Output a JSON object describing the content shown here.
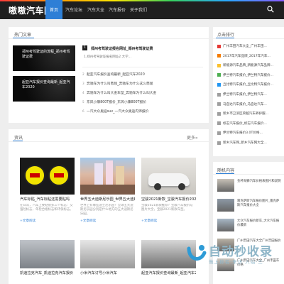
{
  "site": {
    "logo": "嗷嗷汽车网"
  },
  "nav": [
    {
      "label": "首页",
      "active": true
    },
    {
      "label": "汽车论坛",
      "active": false
    },
    {
      "label": "汽车大全",
      "active": false
    },
    {
      "label": "汽车报价",
      "active": false
    },
    {
      "label": "关于我们",
      "active": false
    }
  ],
  "hot": {
    "title": "热门文章",
    "featured": [
      {
        "label": "郑州考驾驶证的流程_郑州考驾驶证费"
      },
      {
        "label": "起亚汽车报价查询最新_起亚汽车2020"
      }
    ],
    "headline": {
      "number": "1",
      "title": "郑州考驾驶证报名网址_郑州考驾驶证费",
      "summary": "1.郑州考驾驶证报名网址2.大学..."
    },
    "list": [
      {
        "number": "2",
        "title": "起亚汽车报价查询最新_起亚汽车2020"
      },
      {
        "number": "3",
        "title": "奔驰车为什么叫憋屈_奔驰车为什么这么憋屈"
      },
      {
        "number": "4",
        "title": "奔驰车为什么叫大金车型_奔驰车为什么叫大金"
      },
      {
        "number": "5",
        "title": "东风小康800T报价_东风小康800T报价"
      },
      {
        "number": "6",
        "title": "一汽大众奥迪suv_一汽大众奥迪内饰报价"
      }
    ]
  },
  "ranking": {
    "title": "点击排行",
    "items": [
      {
        "text": "广州丰田汽车大全_广州丰田..."
      },
      {
        "text": "2017年汽车品牌_2017年汽车..."
      },
      {
        "text": "新能源汽车品牌_新能源汽车品牌..."
      },
      {
        "text": "伊兰特汽车报价_伊兰特汽车报价..."
      },
      {
        "text": "丘比特汽车报价_丘比特汽车报价..."
      },
      {
        "text": "伊兰特汽车报价_伊兰特汽车..."
      },
      {
        "text": "马自达汽车报价_马自达汽车..."
      },
      {
        "text": "新乡市卫滨区荣越汽车养护服..."
      },
      {
        "text": "标志汽车报价_标志汽车报价..."
      },
      {
        "text": "伊兰特汽车报价3.0T价格..."
      },
      {
        "text": "新乡汽车网_新乡汽车网大全..."
      }
    ]
  },
  "news": {
    "title": "资讯",
    "more": "更多»",
    "read_more": "+文章阅读",
    "cards": [
      {
        "title": "汽车标贴_汽车标贴还需要贴吗",
        "desc": "在日常，汽车上要贴很多三个标志：交强险标志、年检合格标志和环保标志。"
      },
      {
        "title": "世界五大迪斯尼乐园_世界五大迪斯尼",
        "desc": "世界上有哪些迪士尼乐园？全球五大迪斯尼乐园分别是什么地方的五大迪斯尼乐园。"
      },
      {
        "title": "宝骏2021新款_宝骏汽车报价2021",
        "desc": "宝骏2021新款推荐？宝骏汽车报价与图片大全，宝骏2021新款车型。"
      },
      {
        "title": "凯迪拉克汽车_凯迪拉克汽车报价",
        "desc": ""
      },
      {
        "title": "小米汽车订号小米汽车",
        "desc": ""
      },
      {
        "title": "起亚汽车报价查询最新_起亚汽车2020",
        "desc": ""
      }
    ]
  },
  "random": {
    "title": "随机内容",
    "items": [
      {
        "text": "金杯海狮汽车价格表图片和说明"
      },
      {
        "text": "雷克萨斯汽车报价图片_雷克萨斯汽车报价大全"
      },
      {
        "text": "大众汽车报价新车_大众汽车报价最新"
      },
      {
        "text": "广州丰田汽车大全广州丰田报价"
      },
      {
        "text": "广州丰田汽车大全_广州丰田车价格"
      }
    ]
  },
  "watermark": {
    "big": "自动秒收录",
    "small": "做上排名·来访·入站·三"
  },
  "colors": {
    "accent": "#2e7fd6",
    "topbar": "#1f1f1f",
    "rank_squares": [
      "#e53935",
      "#f57c00",
      "#fbc02d",
      "#4caf50",
      "#2196f3",
      "#9e9e9e",
      "#9e9e9e",
      "#9e9e9e",
      "#9e9e9e",
      "#9e9e9e",
      "#9e9e9e"
    ]
  }
}
